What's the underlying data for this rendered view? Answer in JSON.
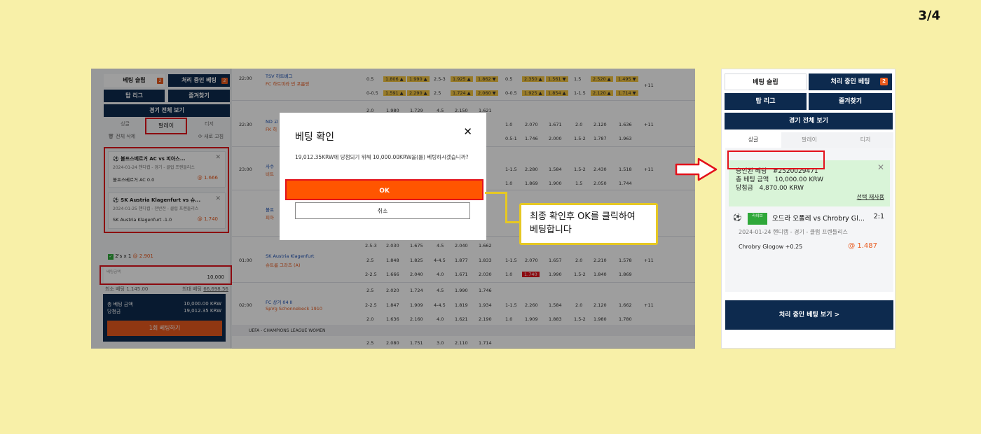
{
  "page_number": "3/4",
  "sidebar": {
    "bet_slip": "베팅 슬립",
    "bet_slip_count": "2",
    "processing_bets": "처리 중인 베팅",
    "processing_count": "2",
    "top_league": "탑 리그",
    "favorites": "즐겨찾기",
    "view_all_games": "경기 전체 보기",
    "tabs": [
      "싱글",
      "팔레이",
      "티저"
    ],
    "delete_all": "전체 삭제",
    "refresh": "새로 고침",
    "slips": [
      {
        "title": "볼프스베르거 AC vs 피아스...",
        "meta": "2024-01-24 핸디캡 - 경기 - 클럽 프렌들리스",
        "pick": "볼프스베르거 AC 0.0",
        "odds": "@ 1.666"
      },
      {
        "title": "SK Austria Klagenfurt vs 슈...",
        "meta": "2024-01-25 핸디캡 - 전반전 - 클럽 프렌들리스",
        "pick": "SK Austria Klagenfurt -1.0",
        "odds": "@ 1.740"
      }
    ],
    "combo": "2's x 1",
    "combo_odds": "@ 2.901",
    "stake_label": "베팅금액",
    "stake_value": "10,000",
    "min_bet": "최소 베팅 1,145.00",
    "max_bet_label": "최대 베팅",
    "max_bet": "66,698.56",
    "total_stake_label": "총 베팅 금액",
    "total_stake": "10,000.00 KRW",
    "payout_label": "당첨금",
    "payout": "19,012.35 KRW",
    "place_bet": "1회 베팅하기"
  },
  "grid": {
    "rows": [
      {
        "time": "22:00",
        "team_a": "TSV 하트베그",
        "team_b": "FC 하트미라 빈 포름링"
      },
      {
        "time": "22:30",
        "team_a": "ND 고",
        "team_b": "FK 히"
      },
      {
        "time": "23:00",
        "team_a": "사수",
        "team_b": "비트"
      },
      {
        "time": "",
        "team_a": "볼프",
        "team_b": "피아"
      },
      {
        "time": "01:00",
        "team_a": "SK Austria Klagenfurt",
        "team_b": "슈트름 그라츠 (A)"
      },
      {
        "time": "02:00",
        "team_a": "FC 상거 04 II",
        "team_b": "SpVg Schonnebeck 1910"
      }
    ],
    "league_footer": "UEFA - CHAMPIONS LEAGUE WOMEN"
  },
  "modal": {
    "title": "베팅 확인",
    "message": "19,012.35KRW에 당첨되기 위해 10,000.00KRW을(를) 베팅하시겠습니까?",
    "ok": "OK",
    "cancel": "취소"
  },
  "callout": {
    "line1": "최종 확인후 OK를 클릭하여",
    "line2": "베팅합니다"
  },
  "right_panel": {
    "bet_slip": "베팅 슬립",
    "processing_bets": "처리 중인 베팅",
    "processing_count": "2",
    "top_league": "탑 리그",
    "favorites": "즐겨찾기",
    "view_all_games": "경기 전체 보기",
    "tabs": [
      "싱글",
      "팔레이",
      "티저"
    ],
    "approved_label": "승인된 베팅",
    "approved_id": "#2520029471",
    "stake_label": "총 베팅 금액",
    "stake_value": "10,000.00 KRW",
    "payout_label": "당첨금",
    "payout_value": "4,870.00 KRW",
    "reuse": "선택 재사용",
    "live": "라이브",
    "match_title": "오드라 오폴레 vs Chrobry Gl...",
    "score": "2:1",
    "match_meta": "2024-01-24 핸디캡 - 경기 - 클럽 프렌들리스",
    "pick": "Chrobry Glogow +0.25",
    "odds": "@ 1.487",
    "view_processing": "처리 중인 베팅 보기 >"
  },
  "colors": {
    "background": "#f8f0a8",
    "navy": "#0d2a4e",
    "orange": "#ff5500",
    "highlight_red": "#e3111b",
    "callout_yellow": "#e6c823"
  }
}
